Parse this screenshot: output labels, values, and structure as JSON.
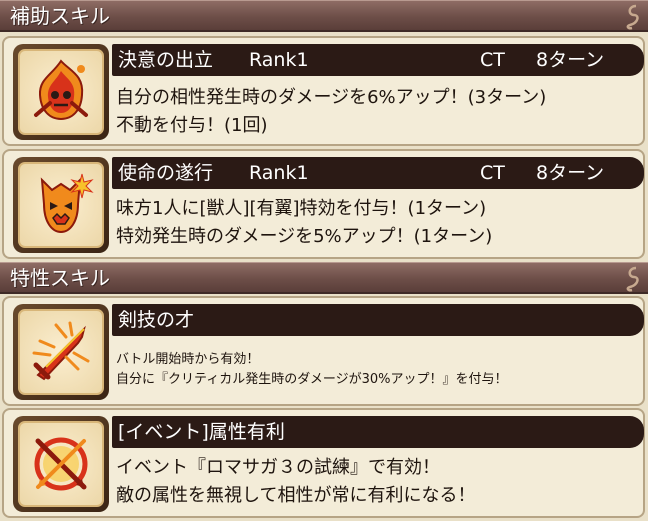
{
  "sections": {
    "support": "補助スキル",
    "trait": "特性スキル"
  },
  "skills": [
    {
      "name": "決意の出立",
      "rank": "Rank1",
      "ct_label": "CT",
      "ct_value": "8ターン",
      "lines": [
        "自分の相性発生時のダメージを6%アップ！(3ターン)",
        "不動を付与！(1回)"
      ],
      "icon": "flame-skull-icon"
    },
    {
      "name": "使命の遂行",
      "rank": "Rank1",
      "ct_label": "CT",
      "ct_value": "8ターン",
      "lines": [
        "味方1人に[獣人][有翼]特効を付与！(1ターン)",
        "特効発生時のダメージを5%アップ！(1ターン)"
      ],
      "icon": "demon-mask-icon"
    },
    {
      "name": "剣技の才",
      "lines": [
        "バトル開始時から有効！",
        "自分に『クリティカル発生時のダメージが30%アップ！』を付与！"
      ],
      "icon": "sword-icon"
    },
    {
      "name": "[イベント]属性有利",
      "lines": [
        "イベント『ロマサガ３の試練』で有効！",
        "敵の属性を無視して相性が常に有利になる！"
      ],
      "icon": "crossed-arrows-icon"
    }
  ],
  "colors": {
    "header": "#6d4e48",
    "title_bar": "#2b1a15",
    "card_bg": "#f3ecd8",
    "icon_red": "#d8321a",
    "icon_orange": "#f08a1c"
  }
}
